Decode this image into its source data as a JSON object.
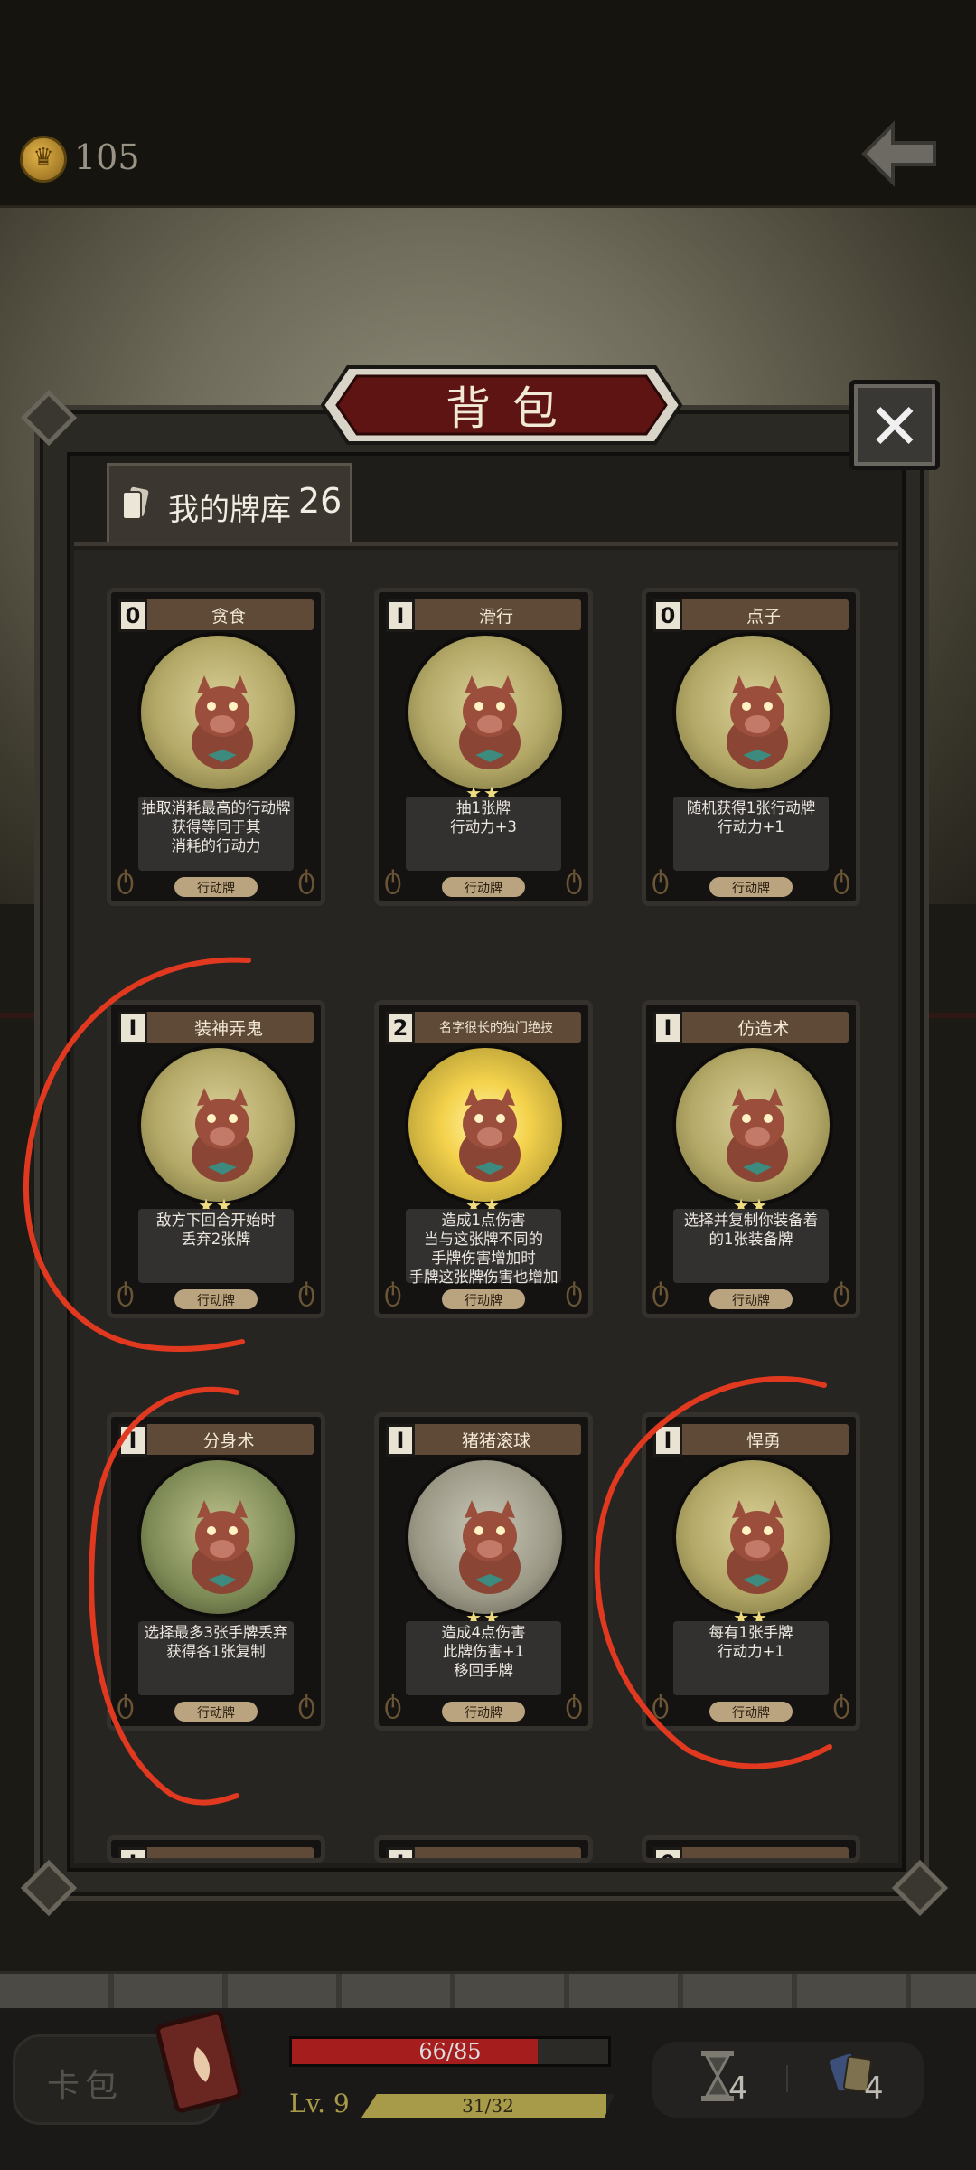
{
  "topbar": {
    "coins": "105",
    "coin_icon": "crown-coin-icon",
    "back_icon": "back-arrow-icon"
  },
  "panel": {
    "title": "背包",
    "close_icon": "close-x-icon"
  },
  "deck": {
    "label": "我的牌库",
    "count": "26"
  },
  "cards": [
    {
      "name": "贪食",
      "cost": "0",
      "stars": "",
      "desc": [
        "抽取消耗最高的行动牌",
        "获得等同于其",
        "消耗的行动力"
      ],
      "type": "行动牌",
      "art": "normal"
    },
    {
      "name": "滑行",
      "cost": "Ⅰ",
      "stars": "★★",
      "desc": [
        "抽1张牌",
        "行动力+3"
      ],
      "type": "行动牌",
      "art": "normal"
    },
    {
      "name": "点子",
      "cost": "0",
      "stars": "",
      "desc": [
        "随机获得1张行动牌",
        "行动力+1"
      ],
      "type": "行动牌",
      "art": "normal"
    },
    {
      "name": "装神弄鬼",
      "cost": "Ⅰ",
      "stars": "★★",
      "desc": [
        "敌方下回合开始时",
        "丢弃2张牌"
      ],
      "type": "行动牌",
      "art": "normal"
    },
    {
      "name": "名字很长的独门绝技",
      "cost": "2",
      "stars": "★★",
      "desc": [
        "造成1点伤害",
        "当与这张牌不同的",
        "手牌伤害增加时",
        "手牌这张牌伤害也增加"
      ],
      "type": "行动牌",
      "art": "hot"
    },
    {
      "name": "仿造术",
      "cost": "Ⅰ",
      "stars": "★★",
      "desc": [
        "选择并复制你装备着",
        "的1张装备牌"
      ],
      "type": "行动牌",
      "art": "normal"
    },
    {
      "name": "分身术",
      "cost": "Ⅰ",
      "stars": "",
      "desc": [
        "选择最多3张手牌丢弃",
        "获得各1张复制"
      ],
      "type": "行动牌",
      "art": "green"
    },
    {
      "name": "猪猪滚球",
      "cost": "Ⅰ",
      "stars": "★★",
      "desc": [
        "造成4点伤害",
        "此牌伤害+1",
        "移回手牌"
      ],
      "type": "行动牌",
      "art": "grey"
    },
    {
      "name": "悍勇",
      "cost": "Ⅰ",
      "stars": "★★",
      "desc": [
        "每有1张手牌",
        "行动力+1"
      ],
      "type": "行动牌",
      "art": "normal"
    }
  ],
  "partial_cards": [
    {
      "cost": "Ⅰ"
    },
    {
      "cost": "Ⅰ"
    },
    {
      "cost": "0"
    }
  ],
  "hud": {
    "pack_label": "卡包",
    "hp_text": "66/85",
    "hp_current": 66,
    "hp_max": 85,
    "level": "Lv. 9",
    "xp_text": "31/32",
    "xp_current": 31,
    "xp_max": 32,
    "hourglass_count": "4",
    "cards_count": "4"
  },
  "colors": {
    "annotation": "#e0391f",
    "hp": "#a51d1d",
    "xp": "#a79a49"
  }
}
